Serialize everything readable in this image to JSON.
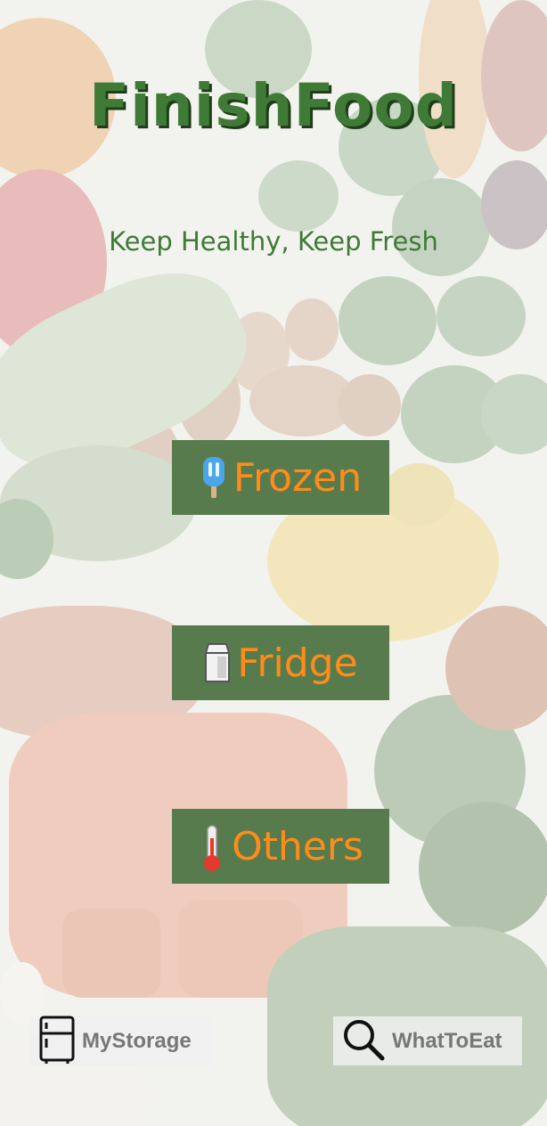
{
  "app": {
    "title": "FinishFood",
    "tagline": "Keep Healthy, Keep Fresh"
  },
  "categories": [
    {
      "label": "Frozen",
      "icon": "popsicle-icon"
    },
    {
      "label": "Fridge",
      "icon": "milk-carton-icon"
    },
    {
      "label": "Others",
      "icon": "thermometer-icon"
    }
  ],
  "tabbar": {
    "storage_label": "MyStorage",
    "storage_icon": "refrigerator-icon",
    "eat_label": "WhatToEat",
    "eat_icon": "search-icon"
  },
  "colors": {
    "title_green": "#3f7a36",
    "button_bg": "#587b4d",
    "button_text": "#ff8c1a",
    "tab_text": "#777777"
  }
}
